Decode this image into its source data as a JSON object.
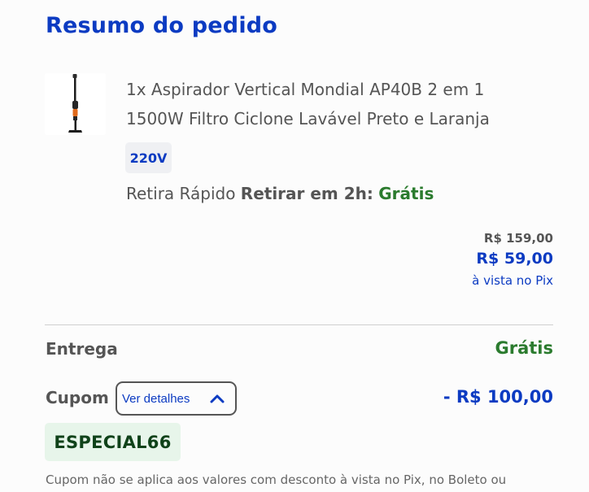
{
  "summary": {
    "title": "Resumo do pedido"
  },
  "product": {
    "name": "1x Aspirador Vertical Mondial AP40B 2 em 1 1500W Filtro Ciclone Lavável Preto e Laranja",
    "voltage": "220V",
    "pickup_label": "Retira Rápido",
    "pickup_time": "Retirar em 2h:",
    "pickup_price": "Grátis",
    "price_old": "R$ 159,00",
    "price_new": "R$ 59,00",
    "price_note": "à vista no Pix",
    "image_icon": "vacuum-cleaner-icon"
  },
  "delivery": {
    "label": "Entrega",
    "value": "Grátis"
  },
  "coupon": {
    "label": "Cupom",
    "details_label": "Ver detalhes",
    "value": "- R$ 100,00",
    "code": "ESPECIAL66",
    "disclaimer": "Cupom não se aplica aos valores com desconto à vista no Pix, no Boleto ou"
  },
  "colors": {
    "brand_blue": "#0c3bc2",
    "success_green": "#2b7b2e",
    "coupon_bg": "#e7f5ea"
  }
}
